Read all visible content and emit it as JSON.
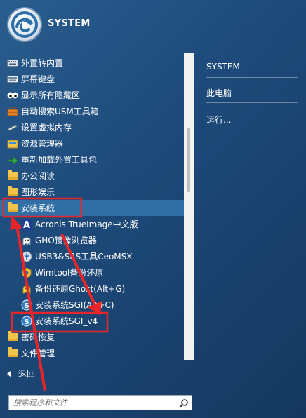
{
  "header": {
    "user_name": "SYSTEM"
  },
  "program_list": {
    "items": [
      {
        "label": "外置转内置",
        "icon": "keyboard-icon"
      },
      {
        "label": "屏幕键盘",
        "icon": "keyboard-icon"
      },
      {
        "label": "显示所有隐藏区",
        "icon": "eyes-icon"
      },
      {
        "label": "自动搜索USM工具箱",
        "icon": "toolbox-icon"
      },
      {
        "label": "设置虚拟内存",
        "icon": "memory-icon"
      },
      {
        "label": "资源管理器",
        "icon": "explorer-icon"
      },
      {
        "label": "重新加载外置工具包",
        "icon": "reload-icon"
      },
      {
        "label": "办公阅读",
        "icon": "folder-icon"
      },
      {
        "label": "图形娱乐",
        "icon": "folder-icon"
      },
      {
        "label": "安装系统",
        "icon": "folder-icon"
      },
      {
        "label": "Acronis TrueImage中文版",
        "icon": "acronis-icon"
      },
      {
        "label": "GHO镜像浏览器",
        "icon": "ghost-icon"
      },
      {
        "label": "USB3&SRS工具CeoMSX",
        "icon": "usb-icon"
      },
      {
        "label": "Wimtool备份还原",
        "icon": "wimtool-icon"
      },
      {
        "label": "备份还原Ghost(Alt+G)",
        "icon": "ghost-icon"
      },
      {
        "label": "安装系统SGI(Alt+C)",
        "icon": "sgi-icon"
      },
      {
        "label": "安装系统SGI_v4",
        "icon": "sgi-icon"
      },
      {
        "label": "密码恢复",
        "icon": "folder-icon"
      },
      {
        "label": "文件管理",
        "icon": "folder-icon"
      }
    ]
  },
  "right_column": {
    "items": [
      "SYSTEM",
      "此电脑",
      "运行..."
    ]
  },
  "back": {
    "label": "返回"
  },
  "search": {
    "placeholder": "搜索程序和文件"
  },
  "colors": {
    "background": "#1e4c7d",
    "selected": "#2f6fa6",
    "annotation": "#e8262a"
  }
}
